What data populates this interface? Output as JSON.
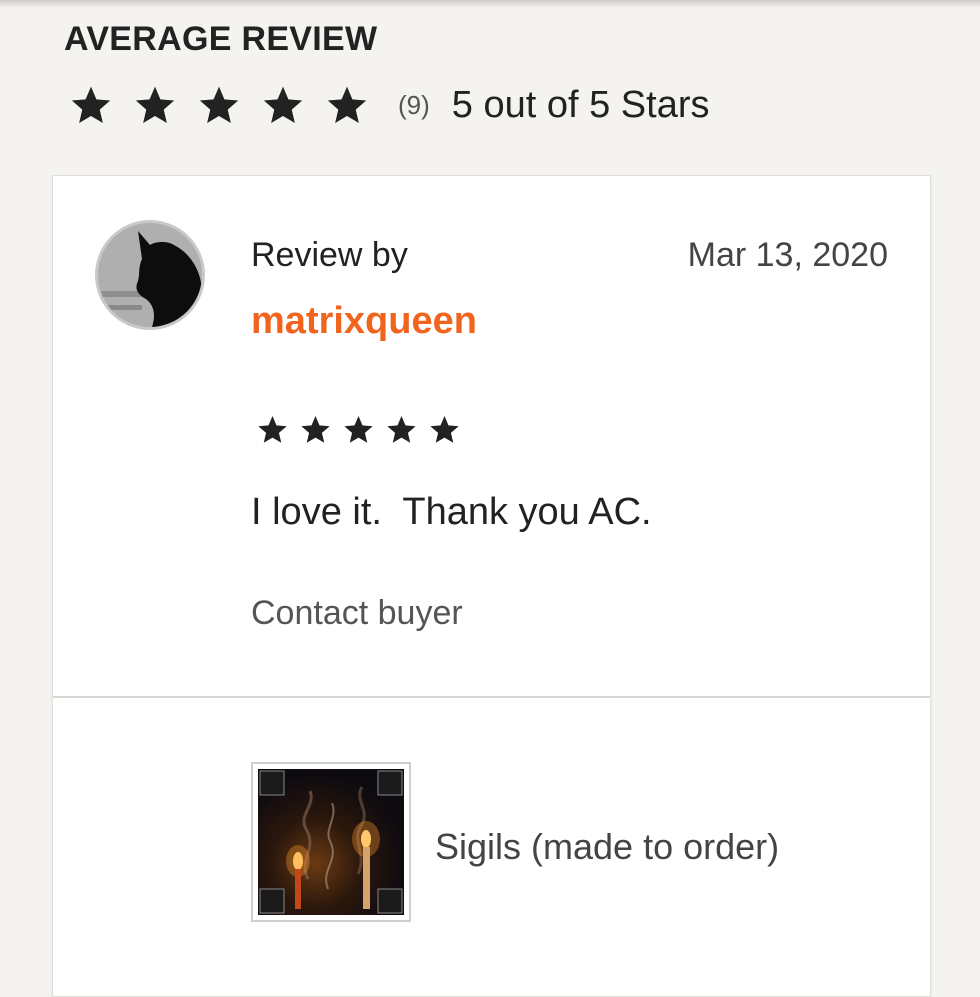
{
  "average_review": {
    "heading": "AVERAGE REVIEW",
    "rating": 5,
    "max_rating": 5,
    "count": "(9)",
    "summary": "5 out of 5 Stars"
  },
  "review": {
    "label": "Review by",
    "username": "matrixqueen",
    "date": "Mar 13, 2020",
    "rating": 5,
    "text": "I love it.  Thank you AC.",
    "contact_label": "Contact buyer"
  },
  "product": {
    "title": "Sigils (made to order)"
  },
  "colors": {
    "accent": "#f1641e",
    "star": "#222222",
    "background": "#f4f3f0",
    "card": "#ffffff"
  },
  "icons": {
    "star": "star-icon",
    "avatar": "cat-silhouette-avatar"
  }
}
